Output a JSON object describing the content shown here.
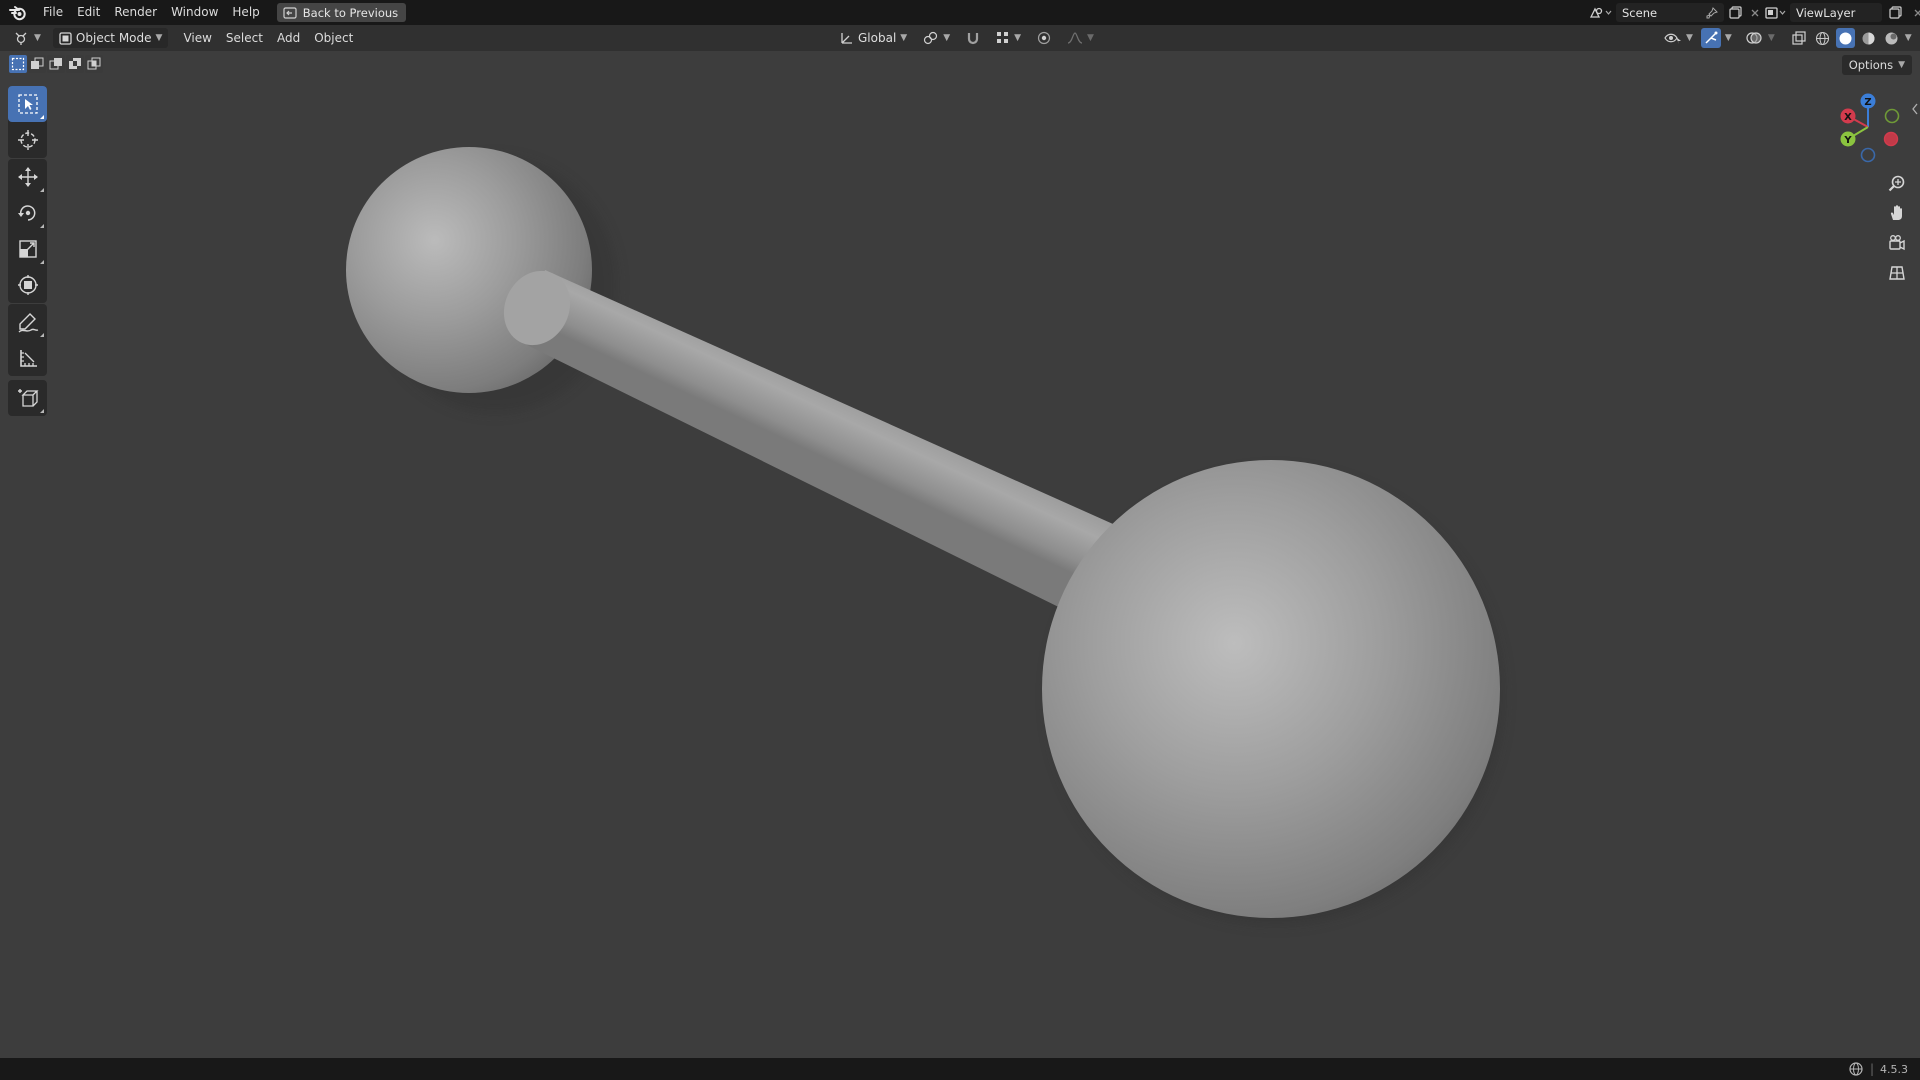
{
  "menu": {
    "items": [
      "File",
      "Edit",
      "Render",
      "Window",
      "Help"
    ],
    "back_button": "Back to Previous"
  },
  "scene": {
    "name": "Scene"
  },
  "view_layer": {
    "name": "ViewLayer"
  },
  "viewport_header": {
    "mode": "Object Mode",
    "menus": [
      "View",
      "Select",
      "Add",
      "Object"
    ],
    "transform_orientation": "Global"
  },
  "options": {
    "label": "Options"
  },
  "toolbar": {
    "tools": [
      "select-box",
      "cursor",
      "move",
      "rotate",
      "scale",
      "transform",
      "annotate",
      "measure",
      "add-cube"
    ],
    "active_tool": "select-box"
  },
  "gizmo": {
    "x_label": "X",
    "y_label": "Y",
    "z_label": "Z"
  },
  "status": {
    "version": "4.5.3"
  },
  "colors": {
    "accent": "#4772b3",
    "viewport_bg": "#3d3d3d",
    "axis_x": "#d33b4d",
    "axis_y": "#8bc43f",
    "axis_z": "#3b7ed8"
  }
}
